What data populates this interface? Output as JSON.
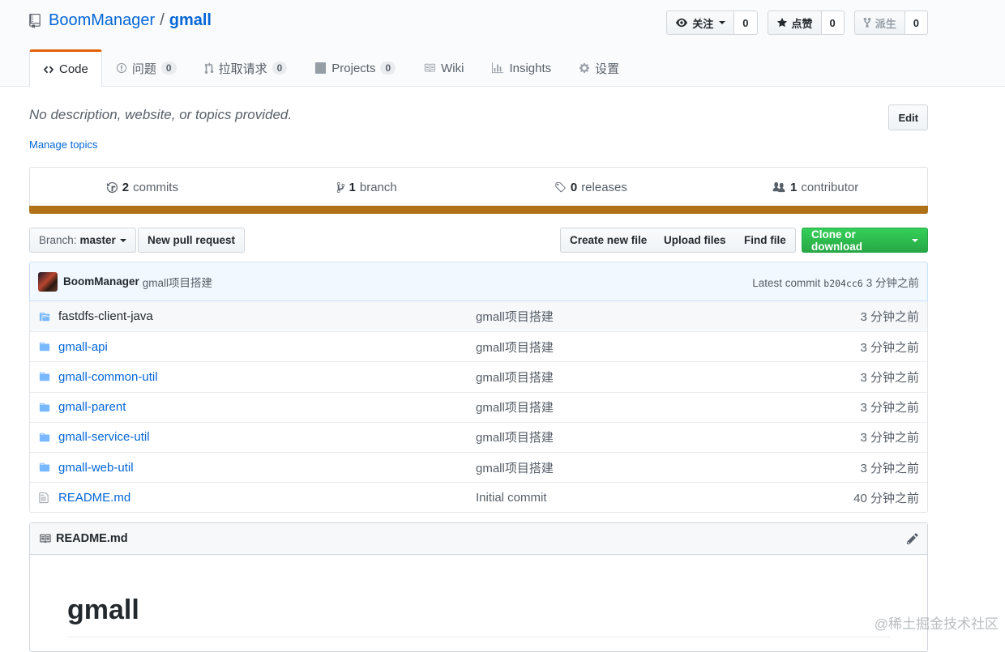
{
  "header": {
    "owner": "BoomManager",
    "separator": "/",
    "repo": "gmall",
    "watch": {
      "label": "关注",
      "count": "0"
    },
    "star": {
      "label": "点赞",
      "count": "0"
    },
    "fork": {
      "label": "派生",
      "count": "0"
    }
  },
  "tabs": [
    {
      "label": "Code"
    },
    {
      "label": "问题",
      "count": "0"
    },
    {
      "label": "拉取请求",
      "count": "0"
    },
    {
      "label": "Projects",
      "count": "0"
    },
    {
      "label": "Wiki"
    },
    {
      "label": "Insights"
    },
    {
      "label": "设置"
    }
  ],
  "meta": {
    "description": "No description, website, or topics provided.",
    "manage_topics": "Manage topics",
    "edit": "Edit"
  },
  "stats": {
    "commits": {
      "num": "2",
      "label": "commits"
    },
    "branches": {
      "num": "1",
      "label": "branch"
    },
    "releases": {
      "num": "0",
      "label": "releases"
    },
    "contributors": {
      "num": "1",
      "label": "contributor"
    },
    "language_color": "#b07219"
  },
  "filenav": {
    "branch_prefix": "Branch:",
    "branch": "master",
    "new_pr": "New pull request",
    "create_file": "Create new file",
    "upload": "Upload files",
    "find": "Find file",
    "clone": "Clone or download"
  },
  "commit": {
    "author": "BoomManager",
    "message": "gmall项目搭建",
    "latest_label": "Latest commit",
    "sha": "b204cc6",
    "age": "3 分钟之前"
  },
  "files": [
    {
      "name": "fastdfs-client-java",
      "type": "submodule",
      "message": "gmall项目搭建",
      "age": "3 分钟之前"
    },
    {
      "name": "gmall-api",
      "type": "dir",
      "message": "gmall项目搭建",
      "age": "3 分钟之前"
    },
    {
      "name": "gmall-common-util",
      "type": "dir",
      "message": "gmall项目搭建",
      "age": "3 分钟之前"
    },
    {
      "name": "gmall-parent",
      "type": "dir",
      "message": "gmall项目搭建",
      "age": "3 分钟之前"
    },
    {
      "name": "gmall-service-util",
      "type": "dir",
      "message": "gmall项目搭建",
      "age": "3 分钟之前"
    },
    {
      "name": "gmall-web-util",
      "type": "dir",
      "message": "gmall项目搭建",
      "age": "3 分钟之前"
    },
    {
      "name": "README.md",
      "type": "file",
      "message": "Initial commit",
      "age": "40 分钟之前"
    }
  ],
  "readme": {
    "filename": "README.md",
    "heading": "gmall"
  },
  "watermark": "@稀土掘金技术社区"
}
